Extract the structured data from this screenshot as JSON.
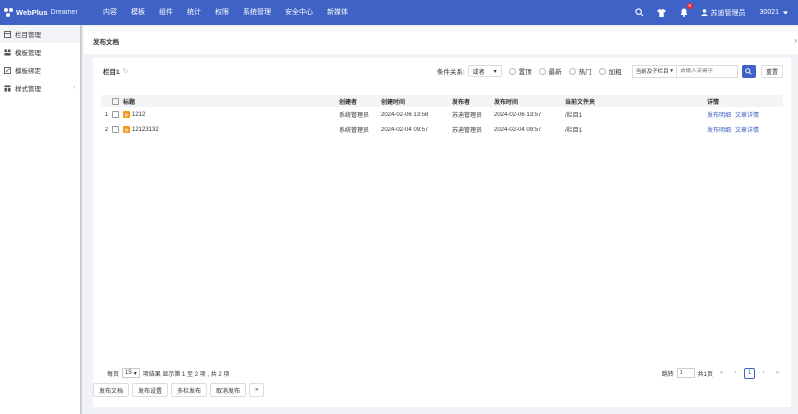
{
  "app": {
    "logo": "WebPlus",
    "product": "Dreamer"
  },
  "nav": [
    "内容",
    "模板",
    "组件",
    "统计",
    "权限",
    "系统管理",
    "安全中心",
    "新媒体"
  ],
  "header": {
    "notification_count": "6",
    "user_name": "苏迪管理员",
    "site_id": "30021"
  },
  "sidebar": {
    "items": [
      {
        "label": "栏目管理",
        "icon": "columns-icon"
      },
      {
        "label": "模板管理",
        "icon": "template-icon"
      },
      {
        "label": "模板绑定",
        "icon": "link-icon"
      },
      {
        "label": "样式管理",
        "icon": "style-icon"
      }
    ]
  },
  "page": {
    "title": "发布文档"
  },
  "toolbar": {
    "crumb": "栏目1",
    "cond_label": "条件关系:",
    "cond_value": "或者",
    "radios": [
      "置顶",
      "最新",
      "热门",
      "加粗"
    ],
    "scope": "当前及子栏目",
    "search_placeholder": "请输入关键字",
    "reset": "重置"
  },
  "table": {
    "headers": [
      "标题",
      "创建者",
      "创建时间",
      "发布者",
      "发布时间",
      "当前文件夹",
      "详情"
    ],
    "rows": [
      {
        "idx": "1",
        "title": "1212",
        "creator": "系统管理员",
        "ctime": "2024-02-06 13:58",
        "publisher": "苏迪管理员",
        "ptime": "2024-02-06 13:57",
        "folder": "/栏目1",
        "d1": "发布明细",
        "d2": "文章详情"
      },
      {
        "idx": "2",
        "title": "12123132",
        "creator": "系统管理员",
        "ctime": "2024-02-04 09:57",
        "publisher": "苏迪管理员",
        "ptime": "2024-02-04 09:57",
        "folder": "/栏目1",
        "d1": "发布明细",
        "d2": "文章详情"
      }
    ]
  },
  "pager": {
    "per_page_label": "每页",
    "per_page": "15",
    "summary": "项结果 显示第 1 至 2 项 , 共 2 项",
    "jump_label": "跳转",
    "jump_value": "1",
    "total_pages": "共1页",
    "current": "1"
  },
  "actions": [
    "发布文档",
    "发布设置",
    "多栏发布",
    "取消发布",
    "»"
  ]
}
